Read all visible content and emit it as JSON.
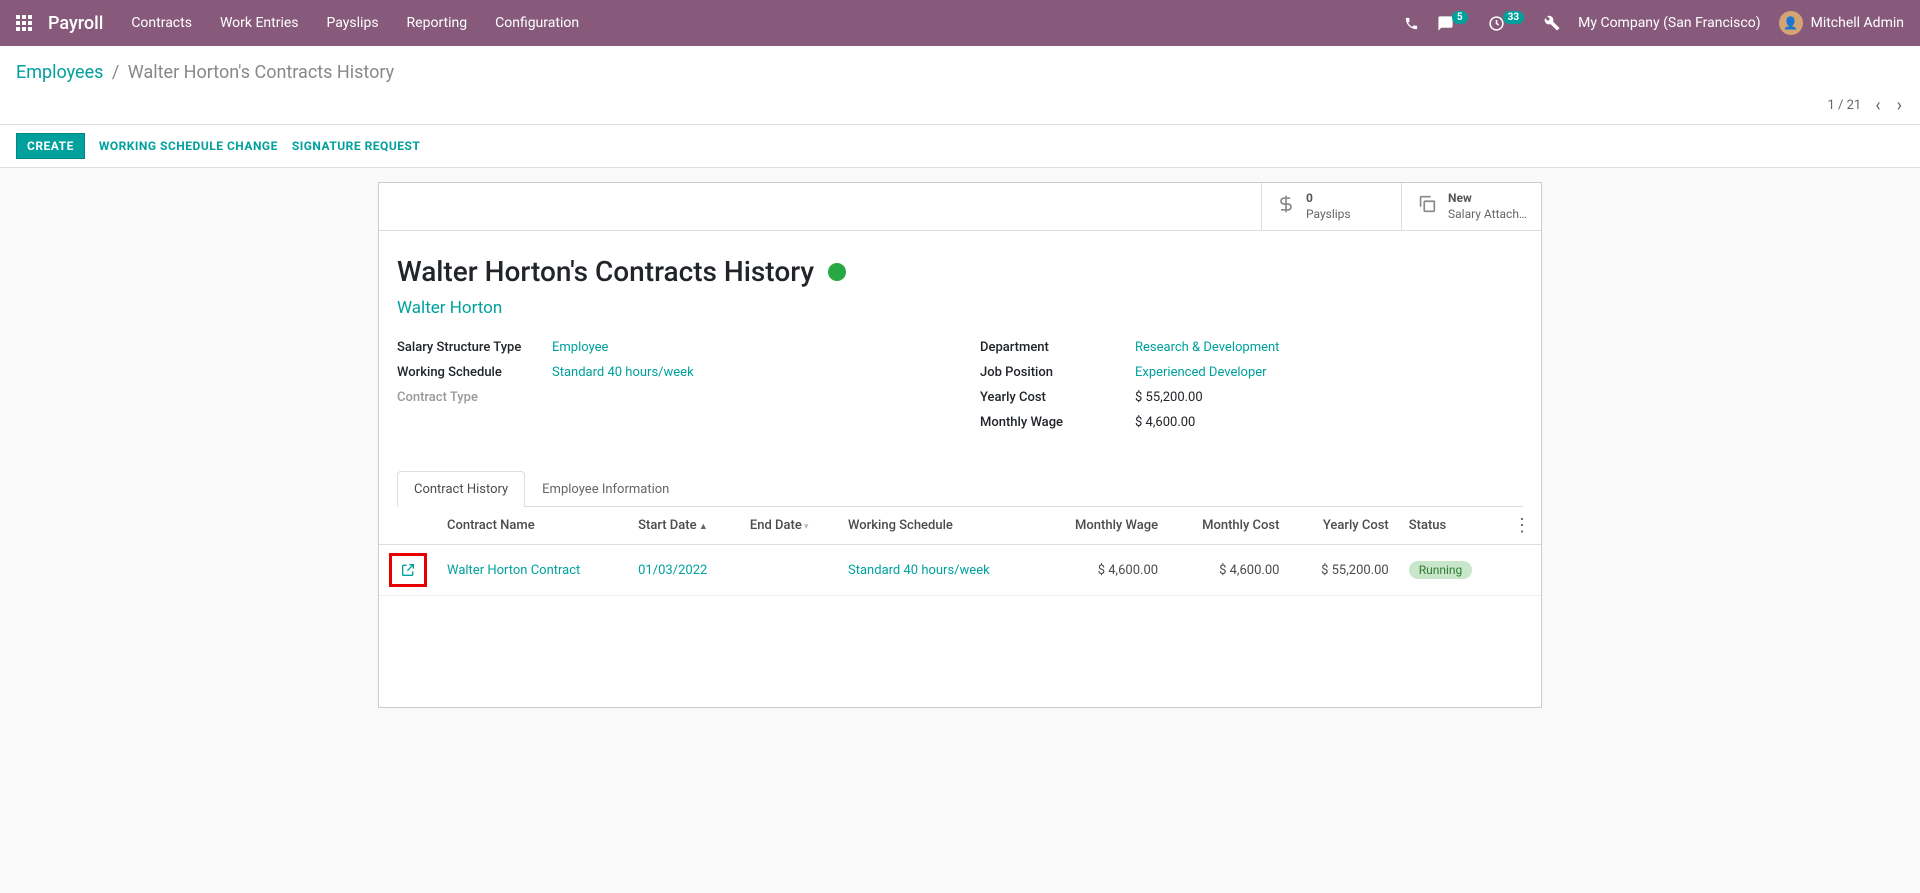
{
  "nav": {
    "app": "Payroll",
    "menu": [
      "Contracts",
      "Work Entries",
      "Payslips",
      "Reporting",
      "Configuration"
    ],
    "msg_badge": "5",
    "activity_badge": "33",
    "company": "My Company (San Francisco)",
    "user": "Mitchell Admin"
  },
  "breadcrumb": {
    "root": "Employees",
    "current": "Walter Horton's Contracts History"
  },
  "pager": {
    "text": "1 / 21"
  },
  "actions": {
    "create": "CREATE",
    "sched": "WORKING SCHEDULE CHANGE",
    "sig": "SIGNATURE REQUEST"
  },
  "stats": {
    "payslips_n": "0",
    "payslips_l": "Payslips",
    "attach_n": "New",
    "attach_l": "Salary Attach…"
  },
  "record": {
    "title": "Walter Horton's Contracts History",
    "employee": "Walter Horton",
    "left": {
      "struct_lbl": "Salary Structure Type",
      "struct_val": "Employee",
      "sched_lbl": "Working Schedule",
      "sched_val": "Standard 40 hours/week",
      "ctype_lbl": "Contract Type"
    },
    "right": {
      "dept_lbl": "Department",
      "dept_val": "Research & Development",
      "job_lbl": "Job Position",
      "job_val": "Experienced Developer",
      "ycost_lbl": "Yearly Cost",
      "ycost_val": "$ 55,200.00",
      "mwage_lbl": "Monthly Wage",
      "mwage_val": "$ 4,600.00"
    }
  },
  "tabs": {
    "t1": "Contract History",
    "t2": "Employee Information"
  },
  "table": {
    "headers": {
      "name": "Contract Name",
      "start": "Start Date",
      "end": "End Date",
      "sched": "Working Schedule",
      "mwage": "Monthly Wage",
      "mcost": "Monthly Cost",
      "ycost": "Yearly Cost",
      "status": "Status"
    },
    "row": {
      "name": "Walter Horton Contract",
      "start": "01/03/2022",
      "end": "",
      "sched": "Standard 40 hours/week",
      "mwage": "$ 4,600.00",
      "mcost": "$ 4,600.00",
      "ycost": "$ 55,200.00",
      "status": "Running"
    }
  }
}
